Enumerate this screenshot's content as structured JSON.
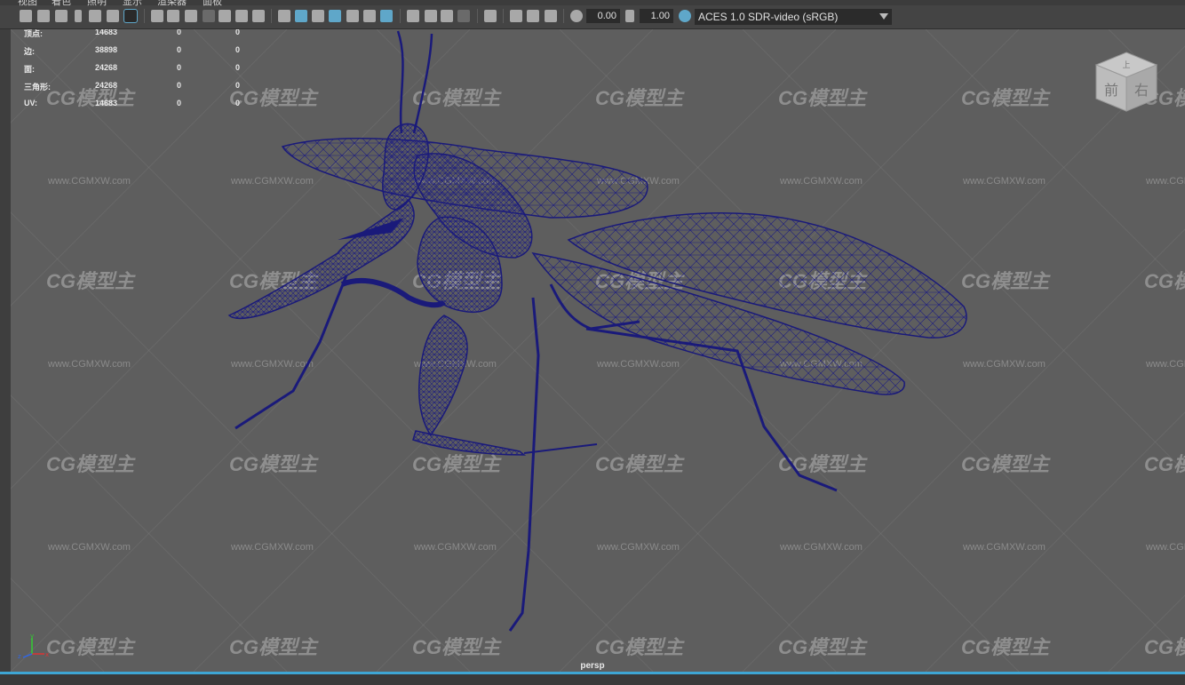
{
  "menu": {
    "items": [
      "视图",
      "着色",
      "照明",
      "显示",
      "渲染器",
      "面板"
    ]
  },
  "toolbar": {
    "exposure_value": "0.00",
    "gamma_value": "1.00",
    "color_space": "ACES 1.0 SDR-video (sRGB)",
    "icons": [
      "camera-icon",
      "lock-camera-icon",
      "bookmark-icon",
      "grid-icon",
      "film-gate-icon",
      "resolution-gate-icon",
      "wireframe-icon",
      "smooth-shade-icon",
      "texture-icon",
      "light-icon",
      "shadow-icon",
      "isolate-icon",
      "xray-icon",
      "exposure-icon",
      "gamma-icon"
    ],
    "accent": "#5fa7c9"
  },
  "hud": {
    "rows": [
      {
        "label": "顶点:",
        "v1": "14683",
        "v2": "0",
        "v3": "0"
      },
      {
        "label": "边:",
        "v1": "38898",
        "v2": "0",
        "v3": "0"
      },
      {
        "label": "面:",
        "v1": "24268",
        "v2": "0",
        "v3": "0"
      },
      {
        "label": "三角形:",
        "v1": "24268",
        "v2": "0",
        "v3": "0"
      },
      {
        "label": "UV:",
        "v1": "14683",
        "v2": "0",
        "v3": "0"
      }
    ]
  },
  "viewcube": {
    "top": "上",
    "front": "前",
    "right": "右"
  },
  "viewport": {
    "camera": "persp",
    "background": "#5e5e5e",
    "wire_color": "#1a1a7a"
  },
  "axis": {
    "x": "x",
    "y": "y",
    "z": "z"
  },
  "watermark": {
    "logo": "CG模型主",
    "url": "www.CGMXW.com"
  }
}
